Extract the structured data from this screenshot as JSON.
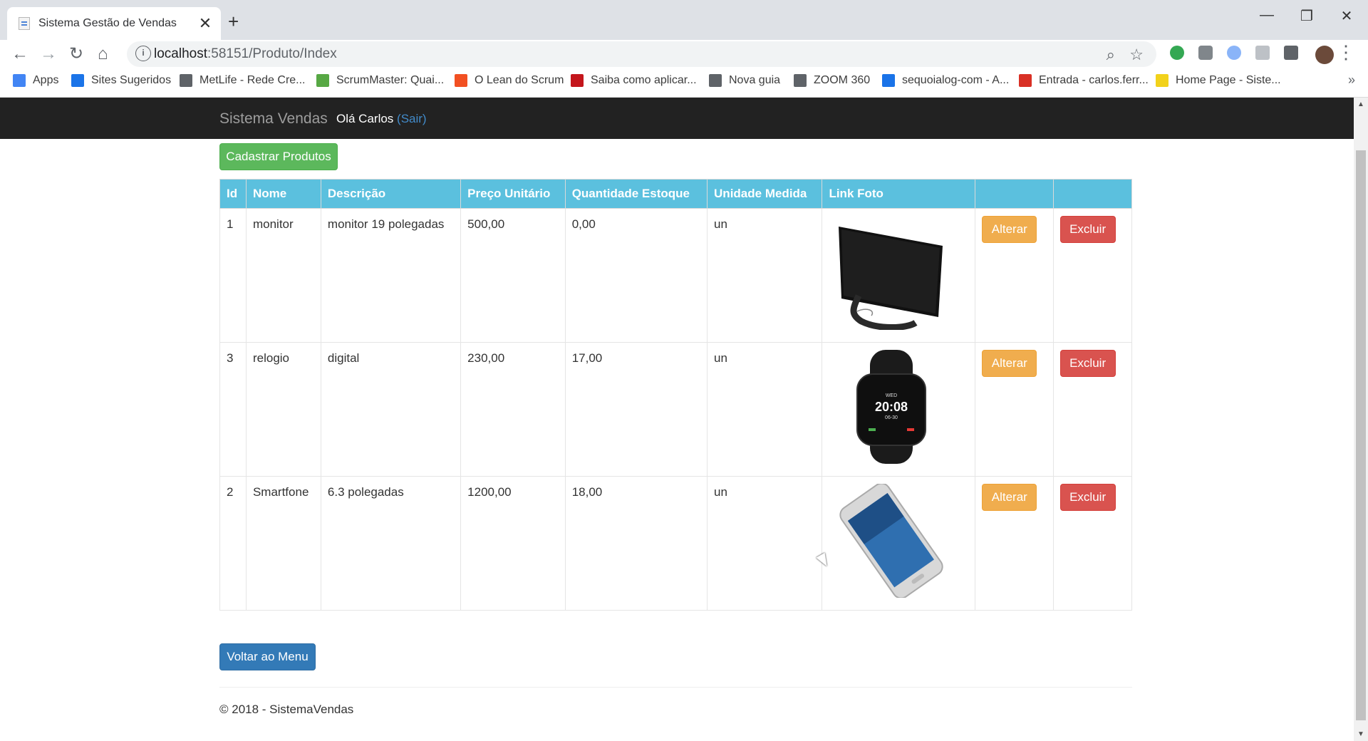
{
  "browser": {
    "tab_title": "Sistema Gestão de Vendas",
    "tab_close": "✕",
    "new_tab": "+",
    "window_minimize": "—",
    "window_restore": "❐",
    "window_close": "✕",
    "back": "←",
    "forward": "→",
    "reload": "↻",
    "home": "⌂",
    "info_icon": "i",
    "address_host": "localhost",
    "address_path": ":58151/Produto/Index",
    "zoom_icon": "⌕",
    "star_icon": "☆",
    "menu_icon": "⋮",
    "bookmarks_more": "»",
    "bookmarks": [
      {
        "label": "Apps",
        "color": "#4285f4"
      },
      {
        "label": "Sites Sugeridos",
        "color": "#1b74e8"
      },
      {
        "label": "MetLife - Rede Cre...",
        "color": "#5f6368"
      },
      {
        "label": "ScrumMaster: Quai...",
        "color": "#57a844"
      },
      {
        "label": "O Lean do Scrum",
        "color": "#f25022"
      },
      {
        "label": "Saiba como aplicar...",
        "color": "#c4161c"
      },
      {
        "label": "Nova guia",
        "color": "#5f6368"
      },
      {
        "label": "ZOOM 360",
        "color": "#5f6368"
      },
      {
        "label": "sequoialog-com - A...",
        "color": "#1a73e8"
      },
      {
        "label": "Entrada - carlos.ferr...",
        "color": "#d93025"
      },
      {
        "label": "Home Page - Siste...",
        "color": "#f2d21b"
      }
    ]
  },
  "site": {
    "brand": "Sistema Vendas",
    "greeting": "Olá Carlos ",
    "logout": "(Sair)"
  },
  "actions": {
    "create": "Cadastrar Produtos",
    "back_to_menu": "Voltar ao Menu"
  },
  "table": {
    "headers": [
      "Id",
      "Nome",
      "Descrição",
      "Preço Unitário",
      "Quantidade Estoque",
      "Unidade Medida",
      "Link Foto",
      "",
      ""
    ],
    "rows": [
      {
        "id": "1",
        "nome": "monitor",
        "descricao": "monitor 19 polegadas",
        "preco": "500,00",
        "quantidade": "0,00",
        "unidade": "un",
        "foto": "monitor",
        "alterar": "Alterar",
        "excluir": "Excluir"
      },
      {
        "id": "3",
        "nome": "relogio",
        "descricao": "digital",
        "preco": "230,00",
        "quantidade": "17,00",
        "unidade": "un",
        "foto": "watch",
        "alterar": "Alterar",
        "excluir": "Excluir"
      },
      {
        "id": "2",
        "nome": "Smartfone",
        "descricao": "6.3 polegadas",
        "preco": "1200,00",
        "quantidade": "18,00",
        "unidade": "un",
        "foto": "phone",
        "alterar": "Alterar",
        "excluir": "Excluir"
      }
    ]
  },
  "watch_face": {
    "day": "WED",
    "time": "20:08",
    "date": "06-30"
  },
  "footer": "© 2018 - SistemaVendas",
  "colors": {
    "navbar": "#222222",
    "table_header": "#5bc0de",
    "success": "#5cb85c",
    "warning": "#f0ad4e",
    "danger": "#d9534f",
    "primary": "#337ab7"
  }
}
